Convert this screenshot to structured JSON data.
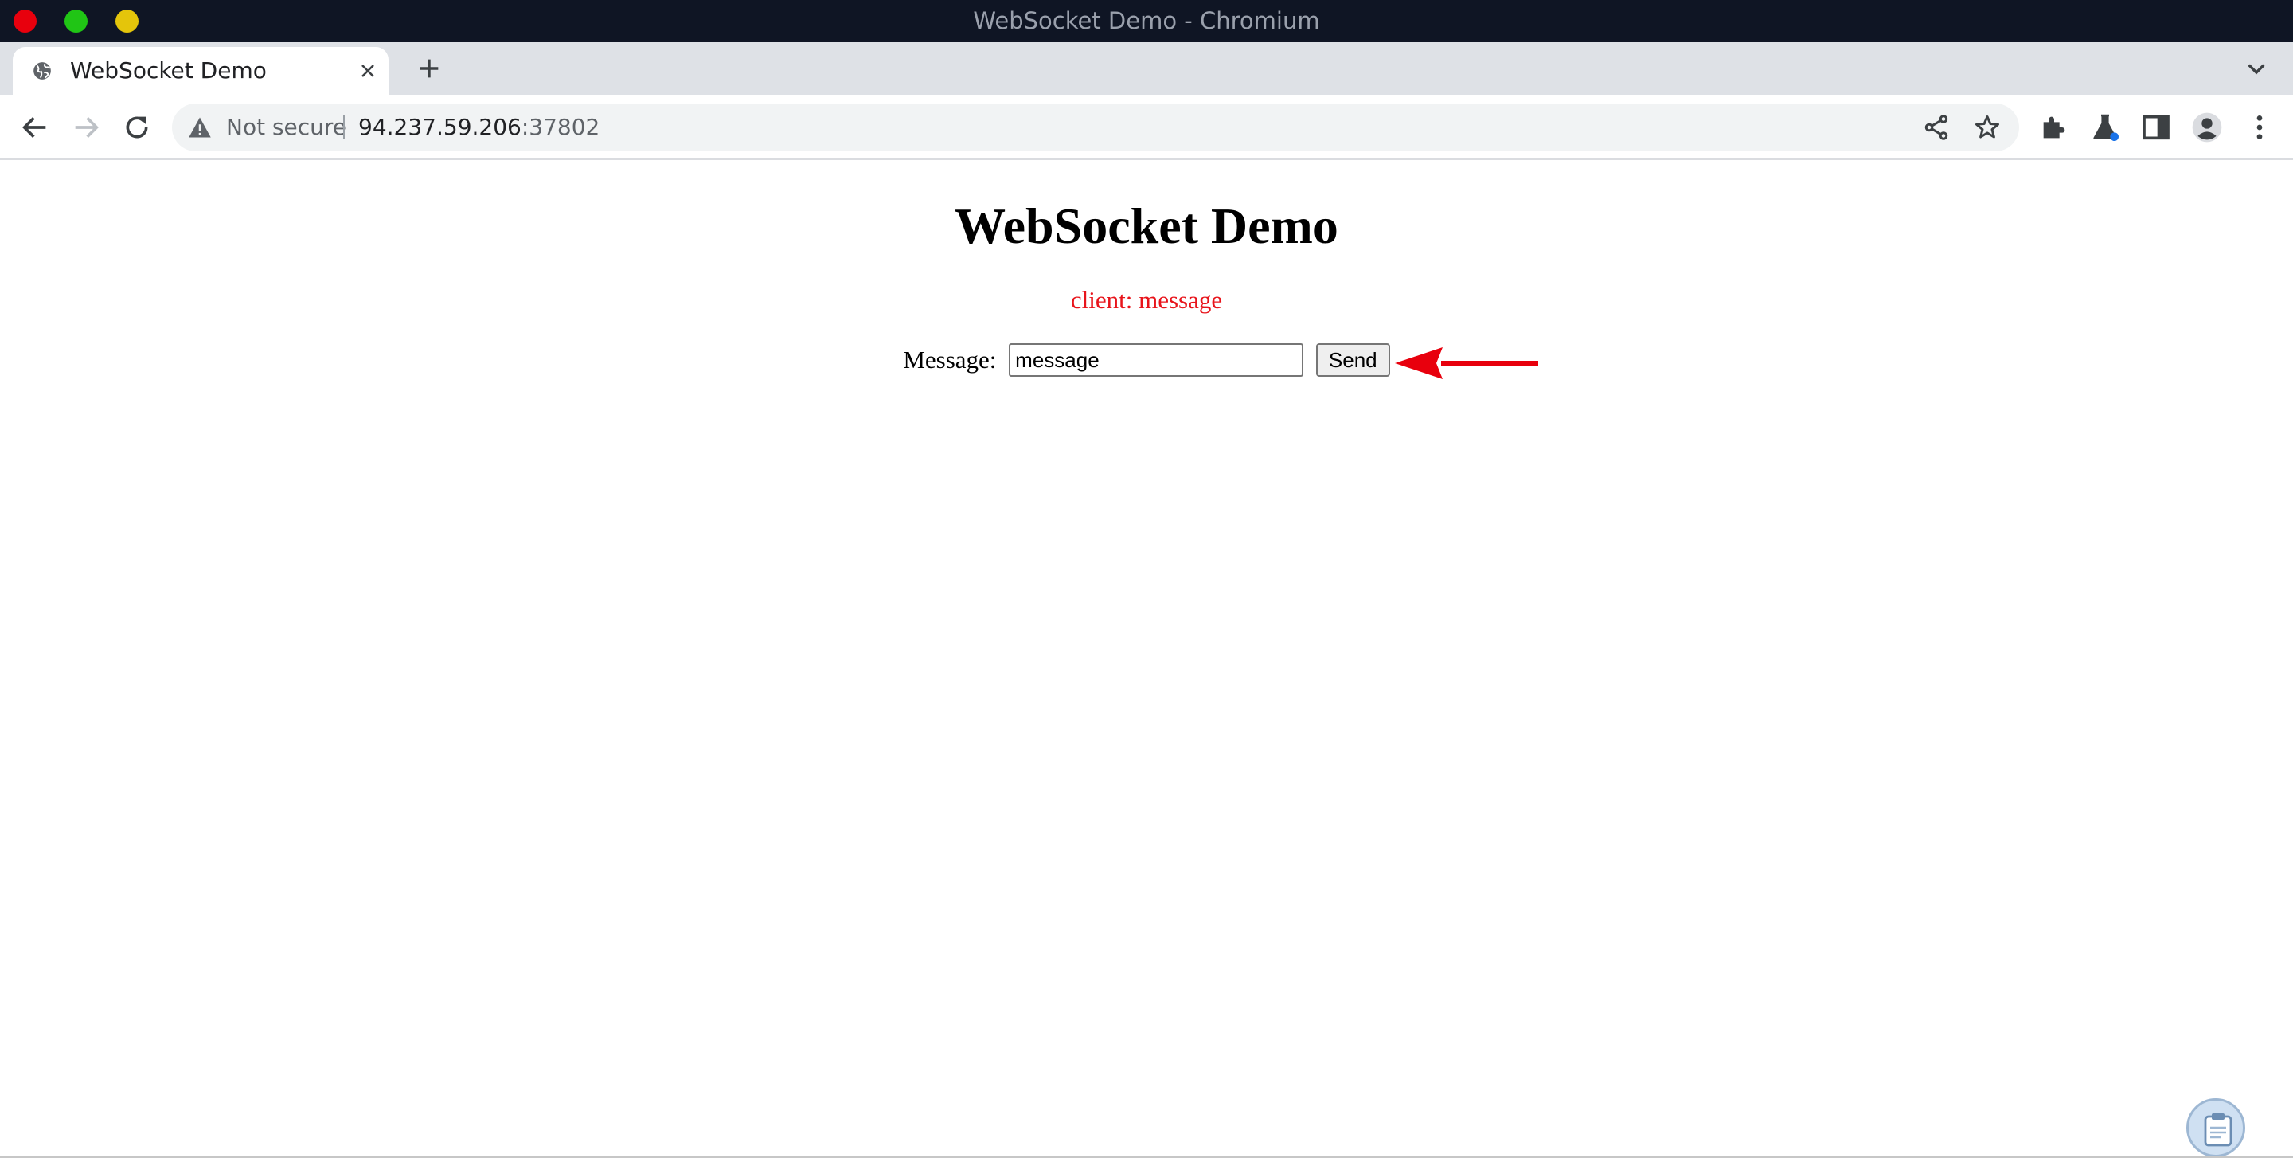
{
  "window": {
    "title": "WebSocket Demo - Chromium"
  },
  "tabs": [
    {
      "title": "WebSocket Demo",
      "favicon": "globe-icon",
      "active": true
    }
  ],
  "toolbar": {
    "security_label": "Not secure",
    "url_host": "94.237.59.206",
    "url_port": ":37802"
  },
  "page": {
    "heading": "WebSocket Demo",
    "status_text": "client: message",
    "message_label": "Message:",
    "message_value": "message",
    "send_label": "Send"
  },
  "colors": {
    "titlebar_bg": "#0f1524",
    "status_text": "#e8141b",
    "annotation_arrow": "#e8000d"
  }
}
